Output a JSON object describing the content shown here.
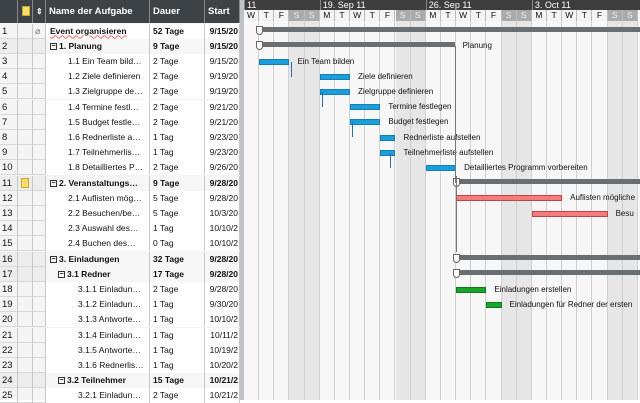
{
  "table": {
    "headers": {
      "name": "Name der Aufgabe",
      "duration": "Dauer",
      "start": "Start"
    },
    "rows": [
      {
        "id": "1",
        "name": "Event organisieren",
        "duration": "52 Tage",
        "start": "9/15/20",
        "level": 0,
        "summary": false,
        "bold": false,
        "attach": true
      },
      {
        "id": "2",
        "name": "1. Planung",
        "duration": "9 Tage",
        "start": "9/15/20",
        "level": 0,
        "summary": true
      },
      {
        "id": "3",
        "name": "1.1 Ein Team bild…",
        "duration": "2 Tage",
        "start": "9/15/20",
        "level": 2
      },
      {
        "id": "4",
        "name": "1.2 Ziele definieren",
        "duration": "2 Tage",
        "start": "9/19/20",
        "level": 2
      },
      {
        "id": "5",
        "name": "1.3 Zielgruppe de…",
        "duration": "2 Tage",
        "start": "9/19/20",
        "level": 2
      },
      {
        "id": "6",
        "name": "1.4 Termine festl…",
        "duration": "2 Tage",
        "start": "9/21/20",
        "level": 2
      },
      {
        "id": "7",
        "name": "1.5 Budget festle…",
        "duration": "2 Tage",
        "start": "9/21/20",
        "level": 2
      },
      {
        "id": "8",
        "name": "1.6 Rednerliste a…",
        "duration": "1 Tag",
        "start": "9/23/20",
        "level": 2
      },
      {
        "id": "9",
        "name": "1.7 Teilnehmerlis…",
        "duration": "1 Tag",
        "start": "9/23/20",
        "level": 2
      },
      {
        "id": "10",
        "name": "1.8 Detailliertes P…",
        "duration": "2 Tage",
        "start": "9/26/20",
        "level": 2
      },
      {
        "id": "11",
        "name": "2. Veranstaltungs…",
        "duration": "9 Tage",
        "start": "9/28/20",
        "level": 0,
        "summary": true,
        "note": true
      },
      {
        "id": "12",
        "name": "2.1 Auflisten mög…",
        "duration": "5 Tage",
        "start": "9/28/20",
        "level": 2
      },
      {
        "id": "13",
        "name": "2.2 Besuchen/be…",
        "duration": "5 Tage",
        "start": "10/3/20",
        "level": 2
      },
      {
        "id": "14",
        "name": "2.3 Auswahl des…",
        "duration": "1 Tag",
        "start": "10/10/2",
        "level": 2
      },
      {
        "id": "15",
        "name": "2.4 Buchen des…",
        "duration": "0 Tag",
        "start": "10/10/2",
        "level": 2
      },
      {
        "id": "16",
        "name": "3.   Einladungen",
        "duration": "32 Tage",
        "start": "9/28/20",
        "level": 0,
        "summary": true
      },
      {
        "id": "17",
        "name": "3.1 Redner",
        "duration": "17 Tage",
        "start": "9/28/20",
        "level": 1,
        "summary": true
      },
      {
        "id": "18",
        "name": "3.1.1 Einladun…",
        "duration": "2 Tage",
        "start": "9/28/20",
        "level": 3
      },
      {
        "id": "19",
        "name": "3.1.2 Einladun…",
        "duration": "1 Tag",
        "start": "9/30/20",
        "level": 3
      },
      {
        "id": "20",
        "name": "3.1.3 Antworte…",
        "duration": "1 Tag",
        "start": "10/10/2",
        "level": 3
      },
      {
        "id": "21",
        "name": "3.1.4 Einladun…",
        "duration": "1 Tag",
        "start": "10/11/2",
        "level": 3
      },
      {
        "id": "22",
        "name": "3.1.5 Antworte…",
        "duration": "1 Tag",
        "start": "10/19/2",
        "level": 3
      },
      {
        "id": "23",
        "name": "3.1.6 Rednerlis…",
        "duration": "1 Tag",
        "start": "10/20/2",
        "level": 3
      },
      {
        "id": "24",
        "name": "3.2 Teilnehmer",
        "duration": "15 Tage",
        "start": "10/21/2",
        "level": 1,
        "summary": true
      },
      {
        "id": "25",
        "name": "3.2.1 Einladun…",
        "duration": "2 Tage",
        "start": "10/21/2",
        "level": 3
      }
    ]
  },
  "gantt": {
    "weeks": [
      {
        "label": "11",
        "day": 0
      },
      {
        "label": "19. Sep 11",
        "day": 5
      },
      {
        "label": "26. Sep 11",
        "day": 12
      },
      {
        "label": "3. Oct 11",
        "day": 19
      }
    ],
    "day_letters": [
      "W",
      "T",
      "F",
      "S",
      "S",
      "M",
      "T",
      "W",
      "T",
      "F",
      "S",
      "S",
      "M",
      "T",
      "W",
      "T",
      "F",
      "S",
      "S",
      "M",
      "T",
      "W",
      "T",
      "F",
      "S",
      "S"
    ],
    "colors": {
      "task": "#1a9fdc",
      "critical": "#f07e7e",
      "green": "#17a52a",
      "summary": "#6b6e70"
    },
    "bars": [
      {
        "row": 0,
        "type": "summary",
        "start": 1,
        "end": 27
      },
      {
        "row": 1,
        "type": "summary",
        "start": 1,
        "end": 13.9,
        "label": "Planung"
      },
      {
        "row": 2,
        "type": "task",
        "start": 1,
        "end": 3,
        "label": "Ein Team bilden"
      },
      {
        "row": 3,
        "type": "task",
        "start": 5,
        "end": 7,
        "label": "Ziele definieren"
      },
      {
        "row": 4,
        "type": "task",
        "start": 5,
        "end": 7,
        "label": "Zielgruppe definieren"
      },
      {
        "row": 5,
        "type": "task",
        "start": 7,
        "end": 9,
        "label": "Termine festlegen"
      },
      {
        "row": 6,
        "type": "task",
        "start": 7,
        "end": 9,
        "label": "Budget festlegen"
      },
      {
        "row": 7,
        "type": "task",
        "start": 9,
        "end": 10,
        "label": "Rednerliste aufstellen"
      },
      {
        "row": 8,
        "type": "task",
        "start": 9,
        "end": 10,
        "label": "Teilnehmerliste aufstellen"
      },
      {
        "row": 9,
        "type": "task",
        "start": 12,
        "end": 14,
        "label": "Detailliertes Programm vorbereiten"
      },
      {
        "row": 10,
        "type": "summary",
        "start": 14,
        "end": 27
      },
      {
        "row": 11,
        "type": "critical",
        "start": 14,
        "end": 21,
        "label": "Auflisten mögliche"
      },
      {
        "row": 12,
        "type": "critical",
        "start": 19,
        "end": 24,
        "label": "Besu"
      },
      {
        "row": 15,
        "type": "summary",
        "start": 14,
        "end": 27
      },
      {
        "row": 16,
        "type": "summary",
        "start": 14,
        "end": 27
      },
      {
        "row": 17,
        "type": "green",
        "start": 14,
        "end": 16,
        "label": "Einladungen erstellen"
      },
      {
        "row": 18,
        "type": "green",
        "start": 16,
        "end": 17,
        "label": "Einladungen für Redner der ersten"
      }
    ]
  }
}
